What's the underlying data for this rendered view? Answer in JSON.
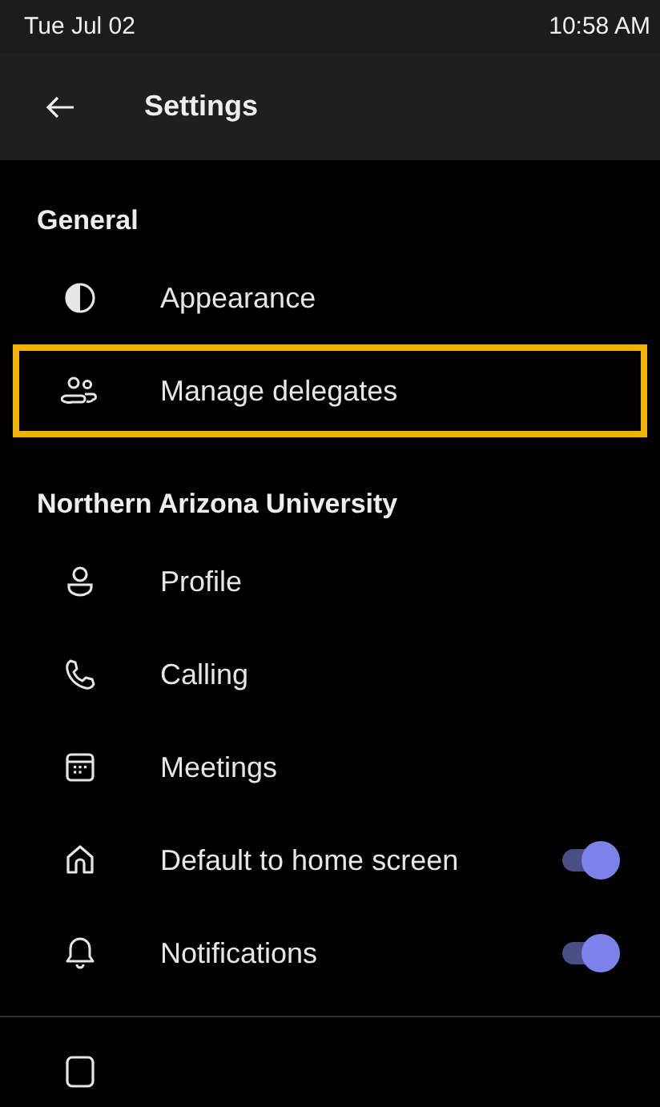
{
  "status_bar": {
    "date": "Tue Jul 02",
    "time": "10:58 AM"
  },
  "header": {
    "title": "Settings"
  },
  "sections": [
    {
      "title": "General",
      "items": [
        {
          "label": "Appearance",
          "kind": "contrast",
          "highlighted": false
        },
        {
          "label": "Manage delegates",
          "kind": "people",
          "highlighted": true
        }
      ]
    },
    {
      "title": "Northern Arizona University",
      "items": [
        {
          "label": "Profile",
          "kind": "person",
          "highlighted": false
        },
        {
          "label": "Calling",
          "kind": "phone",
          "highlighted": false
        },
        {
          "label": "Meetings",
          "kind": "calendar",
          "highlighted": false
        },
        {
          "label": "Default to home screen",
          "kind": "home",
          "highlighted": false,
          "toggle": {
            "on": true
          }
        },
        {
          "label": "Notifications",
          "kind": "bell",
          "highlighted": false,
          "toggle": {
            "on": true
          }
        }
      ]
    }
  ]
}
